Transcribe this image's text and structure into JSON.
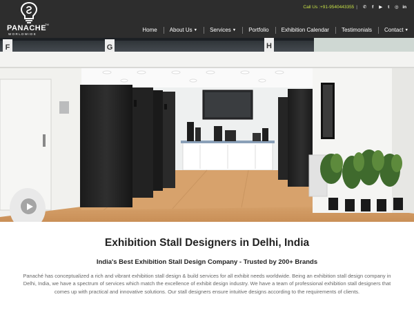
{
  "brand": {
    "name": "PANACHE",
    "tm": "TM",
    "subtitle": "WORLDWIDE"
  },
  "topbar": {
    "call_label": "Call Us :",
    "phone": "+91-9540443355",
    "separator": "|",
    "social": [
      {
        "name": "whatsapp-icon",
        "glyph": "✆"
      },
      {
        "name": "facebook-icon",
        "glyph": "f"
      },
      {
        "name": "youtube-icon",
        "glyph": "▶"
      },
      {
        "name": "twitter-icon",
        "glyph": "t"
      },
      {
        "name": "instagram-icon",
        "glyph": "◎"
      },
      {
        "name": "linkedin-icon",
        "glyph": "in"
      }
    ]
  },
  "nav": {
    "home": "Home",
    "about": "About Us",
    "services": "Services",
    "portfolio": "Portfolio",
    "calendar": "Exhibition Calendar",
    "testimonials": "Testimonials",
    "contact": "Contact",
    "caret": "▼"
  },
  "hero": {
    "booth_letters": [
      "F",
      "G",
      "H"
    ]
  },
  "main": {
    "title": "Exhibition Stall Designers in Delhi, India",
    "subtitle": "India's Best Exhibition Stall Design Company - Trusted by 200+ Brands",
    "description": "Panaché has conceptualized a rich and vibrant exhibition stall design & build services for all exhibit needs worldwide. Being an exhibition stall design company in Delhi, India, we have a spectrum of services which match the excellence of exhibit design industry. We have a team of professional exhibition stall designers that comes up with practical and innovative solutions. Our stall designers ensure intuitive designs according to the requirements of clients."
  },
  "colors": {
    "header_bg": "#2d2d2d",
    "accent": "#c6e046"
  }
}
